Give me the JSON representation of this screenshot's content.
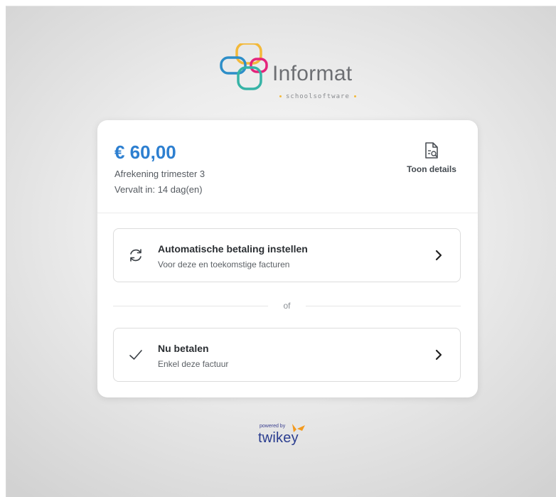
{
  "brand": {
    "name": "Informat",
    "tagline": "schoolsoftware",
    "colors": [
      "#f3b93a",
      "#2d8ec8",
      "#e4247b",
      "#36b3a6"
    ]
  },
  "invoice": {
    "amount": "€ 60,00",
    "description": "Afrekening trimester 3",
    "due": "Vervalt in: 14 dag(en)",
    "details_label": "Toon details",
    "details_icon": "document-search-icon"
  },
  "options": {
    "automatic": {
      "title": "Automatische betaling instellen",
      "subtitle": "Voor deze en toekomstige facturen",
      "icon": "sync-icon"
    },
    "separator": "of",
    "pay_now": {
      "title": "Nu betalen",
      "subtitle": "Enkel deze factuur",
      "icon": "check-icon"
    }
  },
  "footer": {
    "powered_by": "powered by",
    "provider": "twikey"
  },
  "colors": {
    "accent": "#2d7fd0",
    "twikey_blue": "#2a3d8f",
    "twikey_orange": "#f39a1e"
  }
}
